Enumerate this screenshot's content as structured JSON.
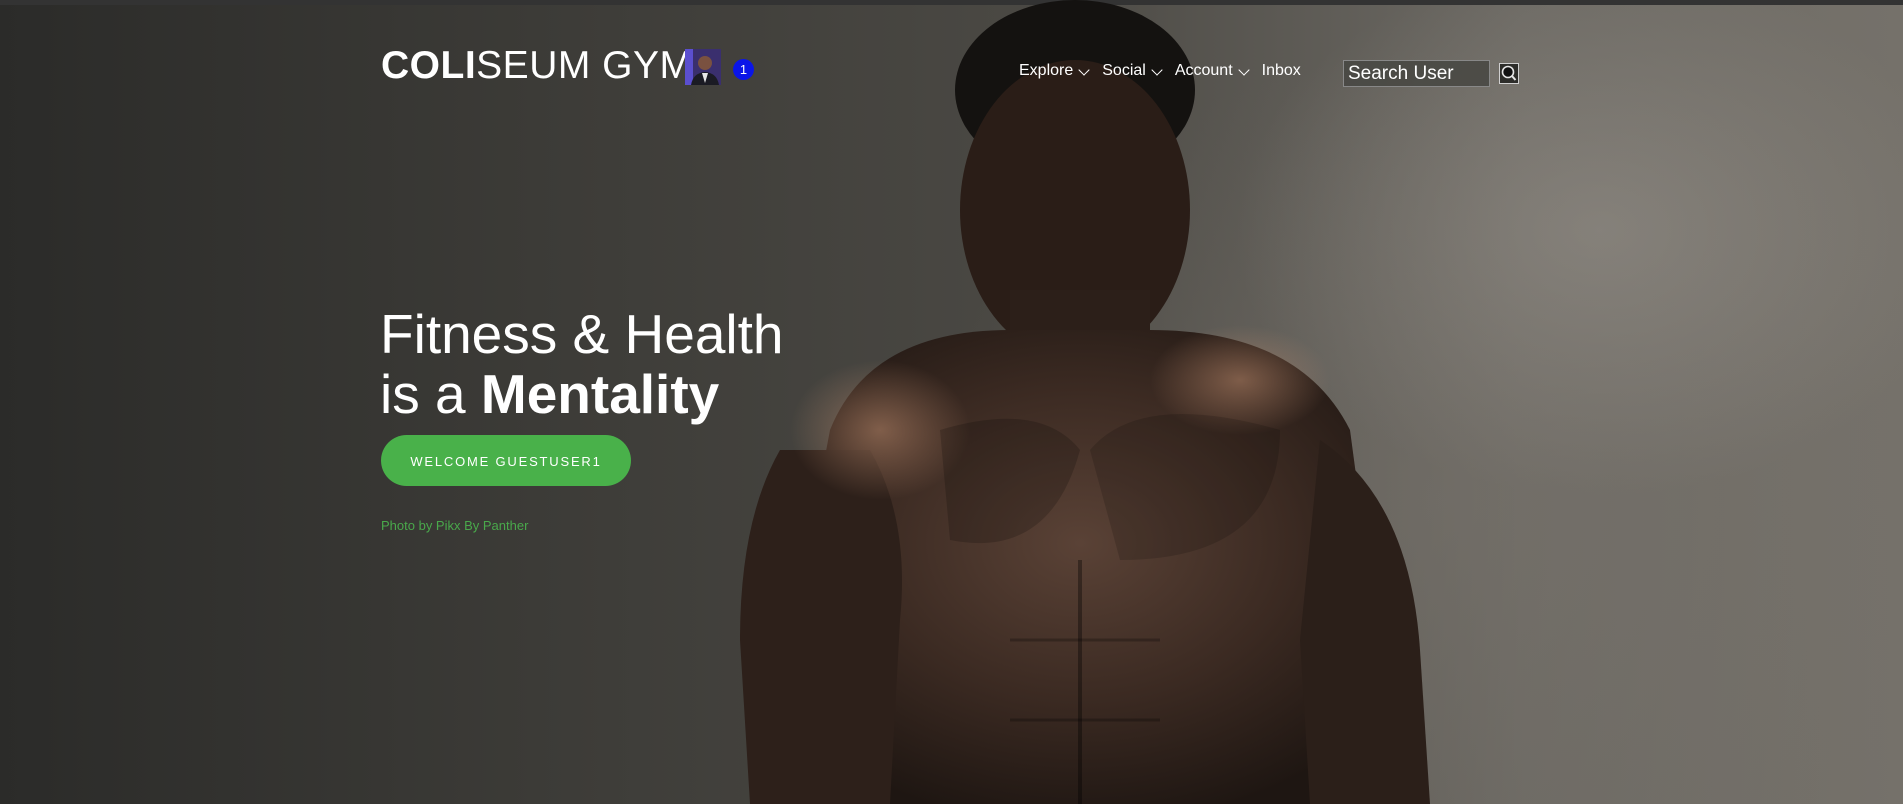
{
  "brand": {
    "logo_bold": "COLI",
    "logo_thin": "SEUM GYM",
    "notification_count": "1"
  },
  "nav": {
    "items": [
      {
        "label": "Explore",
        "has_dropdown": true
      },
      {
        "label": "Social",
        "has_dropdown": true
      },
      {
        "label": "Account",
        "has_dropdown": true
      },
      {
        "label": "Inbox",
        "has_dropdown": false
      }
    ]
  },
  "search": {
    "placeholder": "Search User",
    "icon": "search-icon"
  },
  "hero": {
    "headline_line1": "Fitness & Health",
    "headline_line2_prefix": "is a ",
    "headline_line2_bold": "Mentality",
    "cta_label": "WELCOME GUESTUSER1",
    "photo_credit": "Photo by Pikx By Panther"
  },
  "colors": {
    "accent_green": "#49b14a",
    "badge_blue": "#0a15e8"
  }
}
